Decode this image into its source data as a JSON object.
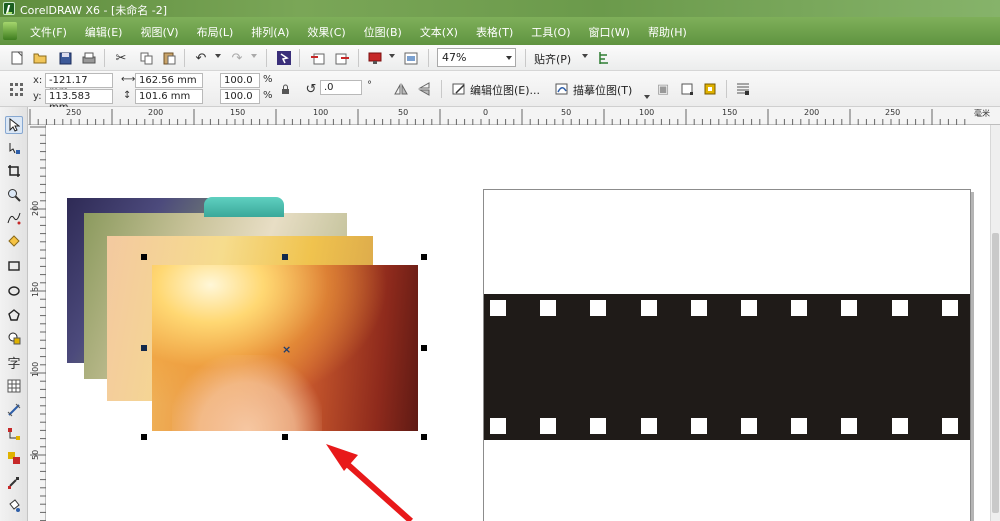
{
  "window": {
    "title": "CorelDRAW X6 - [未命名 -2]"
  },
  "menu": [
    "文件(F)",
    "编辑(E)",
    "视图(V)",
    "布局(L)",
    "排列(A)",
    "效果(C)",
    "位图(B)",
    "文本(X)",
    "表格(T)",
    "工具(O)",
    "窗口(W)",
    "帮助(H)"
  ],
  "toolbar": {
    "zoom_value": "47%",
    "snap_label": "贴齐(P)",
    "icons": [
      "new-icon",
      "open-icon",
      "save-icon",
      "print-icon",
      "cut-icon",
      "copy-icon",
      "paste-icon",
      "undo-icon",
      "redo-icon",
      "search-content-icon",
      "import-icon",
      "export-icon",
      "publish-pdf-icon",
      "app-launcher-icon",
      "options-icon"
    ]
  },
  "property_bar": {
    "x_label": "x:",
    "x_value": "-121.17 mm",
    "y_label": "y:",
    "y_value": "113.583 mm",
    "width_value": "162.56 mm",
    "height_value": "101.6 mm",
    "scale_x": "100.0",
    "scale_y": "100.0",
    "percent": "%",
    "rotation": ".0",
    "degree": "°",
    "edit_bitmap": "编辑位图(E)...",
    "trace_bitmap": "描摹位图(T)"
  },
  "ruler": {
    "unit": "毫米",
    "h_labels": [
      "250",
      "200",
      "150",
      "100",
      "50",
      "0",
      "50",
      "100",
      "150",
      "200",
      "250"
    ],
    "v_labels": [
      "200",
      "150",
      "100",
      "50"
    ]
  },
  "colors": {
    "accent": "#6b9a4b",
    "filmstrip": "#1f1b18",
    "arrow": "#e8191a"
  }
}
